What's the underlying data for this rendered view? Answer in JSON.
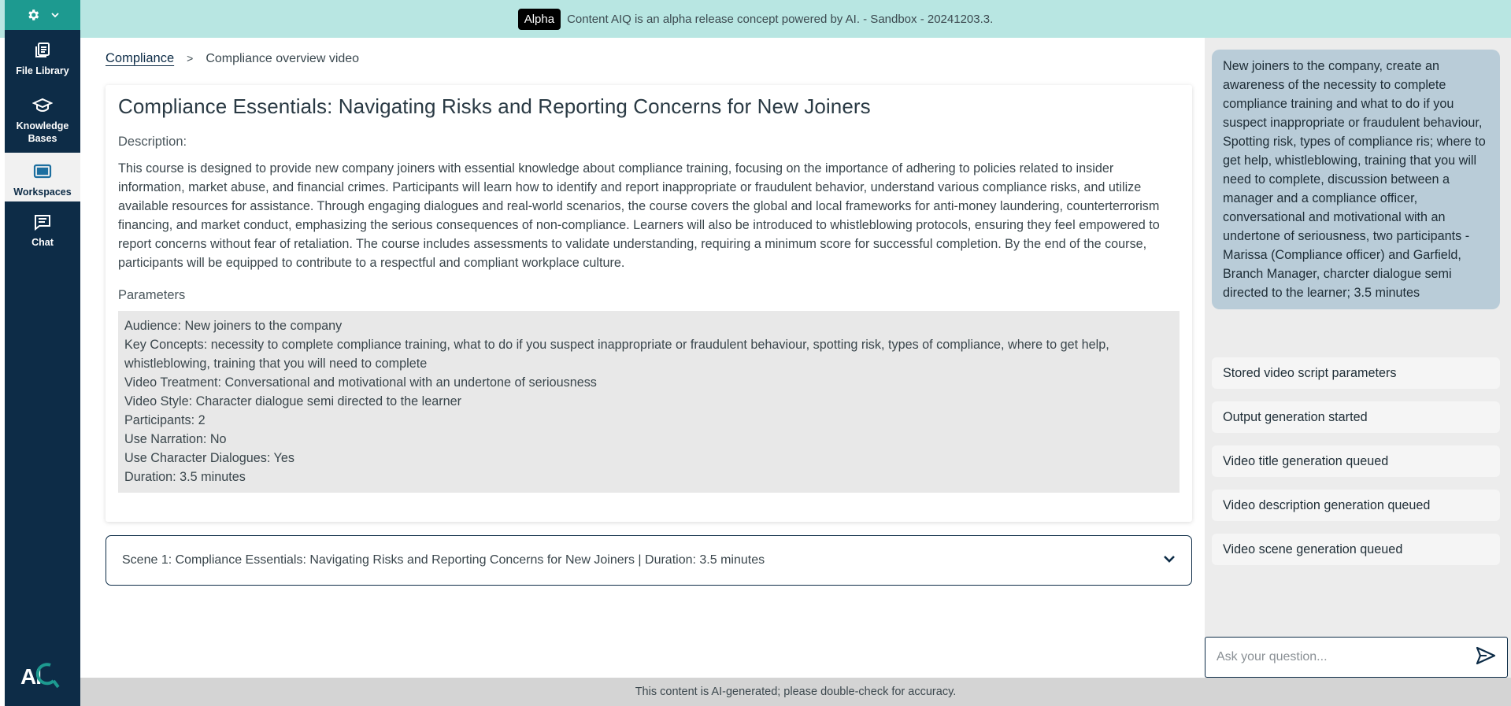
{
  "banner": {
    "badge": "Alpha",
    "text": "Content AIQ is an alpha release concept powered by AI. - Sandbox - 20241203.3."
  },
  "nav": {
    "items": [
      {
        "label": "File Library",
        "icon": "file-library-icon"
      },
      {
        "label": "Knowledge Bases",
        "icon": "graduation-cap-icon"
      },
      {
        "label": "Workspaces",
        "icon": "workspaces-icon",
        "active": true
      },
      {
        "label": "Chat",
        "icon": "chat-icon"
      }
    ],
    "logo": "AI"
  },
  "breadcrumb": {
    "parent": "Compliance",
    "separator": ">",
    "current": "Compliance overview video"
  },
  "course": {
    "title": "Compliance Essentials: Navigating Risks and Reporting Concerns for New Joiners",
    "description_label": "Description:",
    "description": "This course is designed to provide new company joiners with essential knowledge about compliance training, focusing on the importance of adhering to policies related to insider information, market abuse, and financial crimes. Participants will learn how to identify and report inappropriate or fraudulent behavior, understand various compliance risks, and utilize available resources for assistance. Through engaging dialogues and real-world scenarios, the course covers the global and local frameworks for anti-money laundering, counterterrorism financing, and market conduct, emphasizing the serious consequences of non-compliance. Learners will also be introduced to whistleblowing protocols, ensuring they feel empowered to report concerns without fear of retaliation. The course includes assessments to validate understanding, requiring a minimum score for successful completion. By the end of the course, participants will be equipped to contribute to a respectful and compliant workplace culture.",
    "parameters_label": "Parameters",
    "parameters": [
      "Audience: New joiners to the company",
      "Key Concepts: necessity to complete compliance training, what to do if you suspect inappropriate or fraudulent behaviour, spotting risk, types of compliance, where to get help, whistleblowing, training that you will need to complete",
      "Video Treatment: Conversational and motivational with an undertone of seriousness",
      "Video Style: Character dialogue semi directed to the learner",
      "Participants: 2",
      "Use Narration: No",
      "Use Character Dialogues: Yes",
      "Duration: 3.5 minutes"
    ]
  },
  "scene": {
    "label": "Scene 1: Compliance Essentials: Navigating Risks and Reporting Concerns for New Joiners | Duration: 3.5 minutes"
  },
  "chat": {
    "user_message": "New joiners to the company, create an awareness of the necessity to complete compliance training and what to do if you suspect inappropriate or fraudulent behaviour, Spotting risk, types of compliance ris; where to get help, whistleblowing, training that you will need to complete, discussion between a manager and a compliance officer, conversational and motivational with an undertone of seriousness, two participants - Marissa (Compliance officer) and Garfield, Branch Manager, charcter dialogue semi directed to the learner; 3.5 minutes",
    "statuses": [
      "Stored video script parameters",
      "Output generation started",
      "Video title generation queued",
      "Video description generation queued",
      "Video scene generation queued"
    ],
    "input_placeholder": "Ask your question..."
  },
  "footer": {
    "text": "This content is AI-generated; please double-check for accuracy."
  },
  "colors": {
    "nav_bg": "#0d2c47",
    "accent": "#1d9a90",
    "banner_bg": "#b8e6e2",
    "user_bubble": "#b9ccd8"
  }
}
